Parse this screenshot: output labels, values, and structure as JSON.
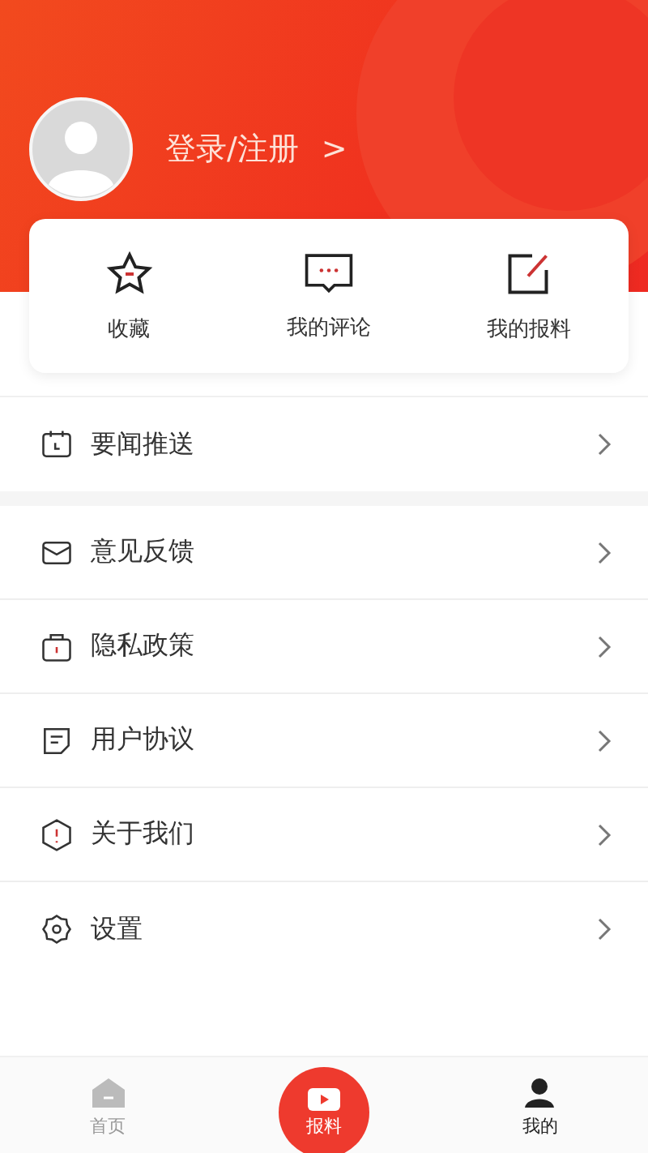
{
  "profile": {
    "login_label": "登录/注册",
    "arrow": ">"
  },
  "quick_actions": [
    {
      "label": "收藏"
    },
    {
      "label": "我的评论"
    },
    {
      "label": "我的报料"
    }
  ],
  "menu_sections": [
    {
      "items": [
        {
          "label": "要闻推送"
        }
      ]
    },
    {
      "items": [
        {
          "label": "意见反馈"
        },
        {
          "label": "隐私政策"
        },
        {
          "label": "用户协议"
        },
        {
          "label": "关于我们"
        },
        {
          "label": "设置"
        }
      ]
    }
  ],
  "bottom_nav": [
    {
      "label": "首页",
      "kind": "tab",
      "selected": false
    },
    {
      "label": "报料",
      "kind": "center",
      "selected": false
    },
    {
      "label": "我的",
      "kind": "tab",
      "selected": true
    }
  ]
}
